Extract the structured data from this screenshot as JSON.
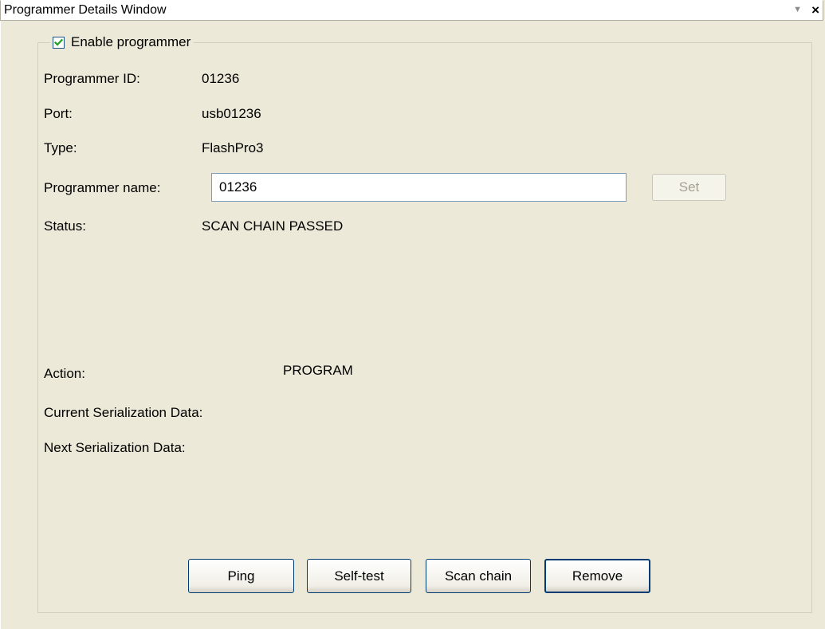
{
  "window": {
    "title": "Programmer Details Window",
    "pin_icon": "pin-dropdown-icon",
    "close_icon": "close-icon",
    "close_glyph": "×"
  },
  "group": {
    "enable_label": "Enable programmer",
    "enable_checked": true
  },
  "fields": {
    "programmer_id_label": "Programmer ID:",
    "programmer_id_value": "01236",
    "port_label": "Port:",
    "port_value": "usb01236",
    "type_label": "Type:",
    "type_value": "FlashPro3",
    "name_label": "Programmer name:",
    "name_value": "01236",
    "set_label": "Set",
    "status_label": "Status:",
    "status_value": "SCAN CHAIN PASSED",
    "action_label": "Action:",
    "action_value": "PROGRAM",
    "current_serial_label": "Current Serialization Data:",
    "next_serial_label": "Next Serialization Data:"
  },
  "buttons": {
    "ping": "Ping",
    "self_test": "Self-test",
    "scan_chain": "Scan chain",
    "remove": "Remove"
  }
}
